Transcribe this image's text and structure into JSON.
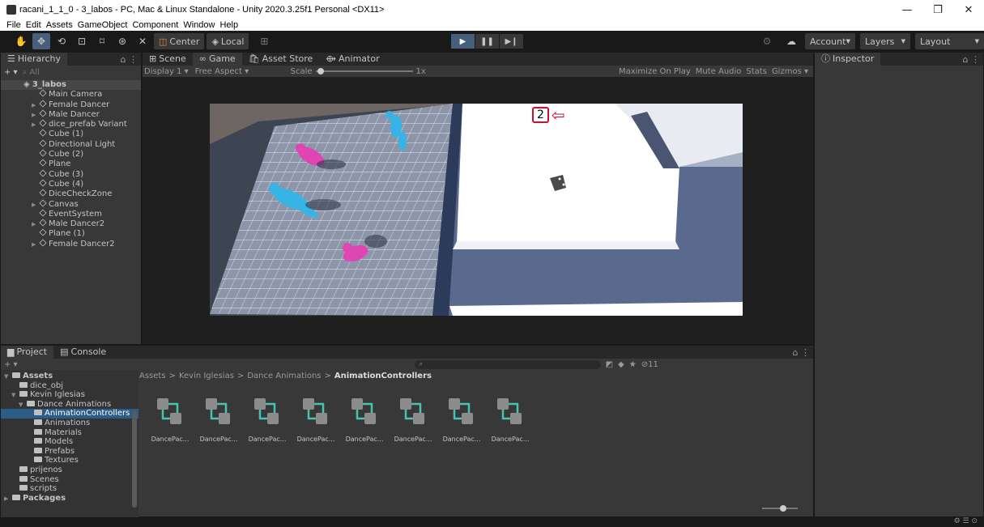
{
  "window": {
    "title": "racani_1_1_0 - 3_labos - PC, Mac & Linux Standalone - Unity 2020.3.25f1 Personal <DX11>",
    "minimize": "—",
    "maximize": "❐",
    "close": "✕"
  },
  "menu": [
    "File",
    "Edit",
    "Assets",
    "GameObject",
    "Component",
    "Window",
    "Help"
  ],
  "toolbar": {
    "pivot": "Center",
    "space": "Local",
    "account": "Account",
    "layers": "Layers",
    "layout": "Layout"
  },
  "hierarchy": {
    "tab": "Hierarchy",
    "search_placeholder": "All",
    "scene": "3_labos",
    "items": [
      {
        "label": "Main Camera",
        "arrow": false
      },
      {
        "label": "Female Dancer",
        "arrow": true
      },
      {
        "label": "Male Dancer",
        "arrow": true
      },
      {
        "label": "dice_prefab Variant",
        "arrow": true
      },
      {
        "label": "Cube (1)",
        "arrow": false
      },
      {
        "label": "Directional Light",
        "arrow": false
      },
      {
        "label": "Cube (2)",
        "arrow": false
      },
      {
        "label": "Plane",
        "arrow": false
      },
      {
        "label": "Cube (3)",
        "arrow": false
      },
      {
        "label": "Cube (4)",
        "arrow": false
      },
      {
        "label": "DiceCheckZone",
        "arrow": false
      },
      {
        "label": "Canvas",
        "arrow": true
      },
      {
        "label": "EventSystem",
        "arrow": false
      },
      {
        "label": "Male Dancer2",
        "arrow": true
      },
      {
        "label": "Plane (1)",
        "arrow": false
      },
      {
        "label": "Female Dancer2",
        "arrow": true
      }
    ]
  },
  "center_tabs": [
    "Scene",
    "Game",
    "Asset Store",
    "Animator"
  ],
  "game": {
    "display": "Display 1",
    "aspect": "Free Aspect",
    "scale_label": "Scale",
    "scale_value": "1x",
    "scale_fraction": 0.02,
    "options": [
      "Maximize On Play",
      "Mute Audio",
      "Stats",
      "Gizmos"
    ],
    "score": "2"
  },
  "inspector": {
    "tab": "Inspector"
  },
  "bottom_tabs": [
    "Project",
    "Console"
  ],
  "project": {
    "tree": [
      {
        "label": "Assets",
        "indent": 0,
        "arrow": "▼",
        "sel": false
      },
      {
        "label": "dice_obj",
        "indent": 1,
        "arrow": "",
        "sel": false
      },
      {
        "label": "Kevin Iglesias",
        "indent": 1,
        "arrow": "▼",
        "sel": false
      },
      {
        "label": "Dance Animations",
        "indent": 2,
        "arrow": "▼",
        "sel": false
      },
      {
        "label": "AnimationControllers",
        "indent": 3,
        "arrow": "",
        "sel": true
      },
      {
        "label": "Animations",
        "indent": 3,
        "arrow": "",
        "sel": false
      },
      {
        "label": "Materials",
        "indent": 3,
        "arrow": "",
        "sel": false
      },
      {
        "label": "Models",
        "indent": 3,
        "arrow": "",
        "sel": false
      },
      {
        "label": "Prefabs",
        "indent": 3,
        "arrow": "",
        "sel": false
      },
      {
        "label": "Textures",
        "indent": 3,
        "arrow": "",
        "sel": false
      },
      {
        "label": "prijenos",
        "indent": 1,
        "arrow": "",
        "sel": false
      },
      {
        "label": "Scenes",
        "indent": 1,
        "arrow": "",
        "sel": false
      },
      {
        "label": "scripts",
        "indent": 1,
        "arrow": "",
        "sel": false
      },
      {
        "label": "Packages",
        "indent": 0,
        "arrow": "▶",
        "sel": false
      }
    ],
    "breadcrumb": [
      "Assets",
      "Kevin Iglesias",
      "Dance Animations",
      "AnimationControllers"
    ],
    "breadcrumb_sep": ">",
    "assets": [
      "DancePac...",
      "DancePac...",
      "DancePac...",
      "DancePac...",
      "DancePac...",
      "DancePac...",
      "DancePac...",
      "DancePac..."
    ],
    "hidden_count": "11"
  },
  "colors": {
    "selection": "#2c5d87",
    "play_active": "#46607c",
    "floor_tile": "#8d95a8",
    "plane_white": "#ffffff",
    "cube_blue": "#5a6a8e",
    "dancer_cyan": "#37b3e6",
    "dancer_pink": "#e045b4",
    "score_border": "#c8102e"
  }
}
